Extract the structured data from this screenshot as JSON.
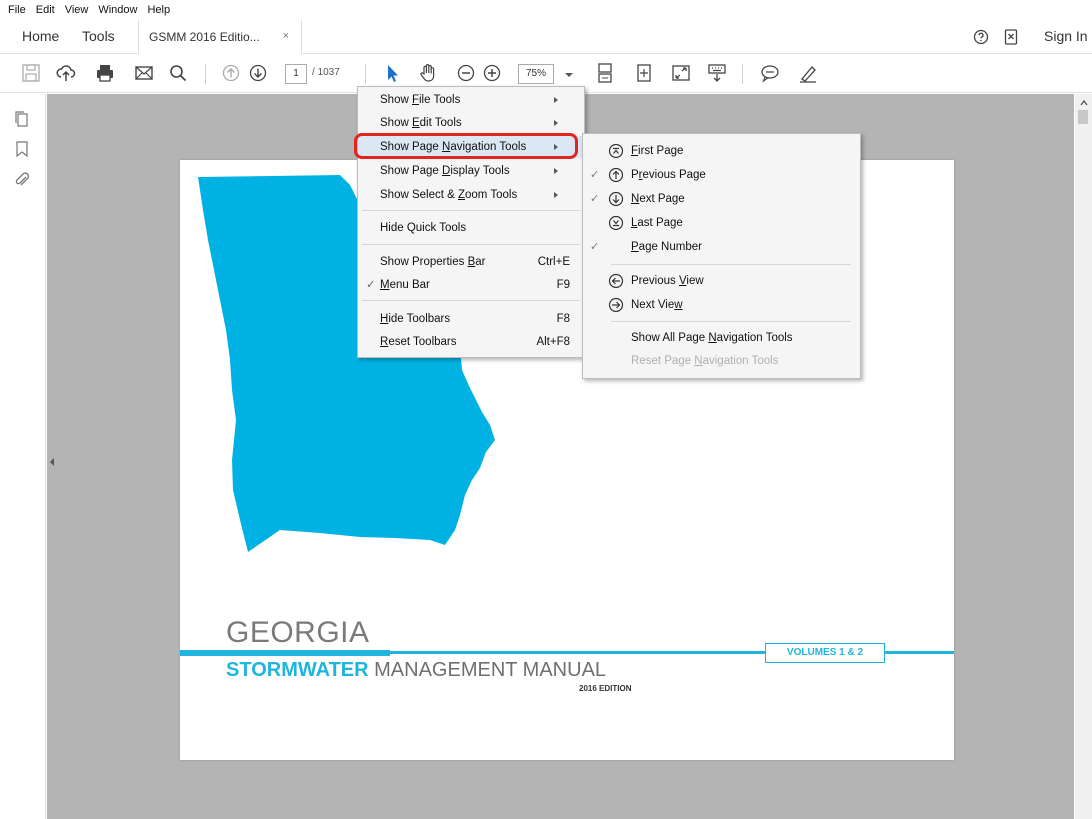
{
  "menubar": {
    "items": [
      "File",
      "Edit",
      "View",
      "Window",
      "Help"
    ]
  },
  "tabs": {
    "home": "Home",
    "tools": "Tools",
    "document": "GSMM 2016 Editio...",
    "close_glyph": "×"
  },
  "header": {
    "sign_in": "Sign In"
  },
  "toolbar": {
    "page_current": "1",
    "page_total": "/ 1037",
    "zoom": "75%"
  },
  "document": {
    "title": "GEORGIA",
    "subtitle_accent": "STORMWATER",
    "subtitle_rest": " MANAGEMENT MANUAL",
    "edition": "2016 EDITION",
    "volumes": "VOLUMES 1 & 2",
    "map_color": "#00b2e3"
  },
  "context_menu": {
    "items": [
      {
        "pre": "Show ",
        "u": "F",
        "post": "ile Tools",
        "shortcut": "",
        "submenu": true,
        "checked": false
      },
      {
        "pre": "Show ",
        "u": "E",
        "post": "dit Tools",
        "shortcut": "",
        "submenu": true,
        "checked": false
      },
      {
        "pre": "Show Page ",
        "u": "N",
        "post": "avigation Tools",
        "shortcut": "",
        "submenu": true,
        "checked": false
      },
      {
        "pre": "Show Page ",
        "u": "D",
        "post": "isplay Tools",
        "shortcut": "",
        "submenu": true,
        "checked": false
      },
      {
        "pre": "Show Select & ",
        "u": "Z",
        "post": "oom Tools",
        "shortcut": "",
        "submenu": true,
        "checked": false
      },
      {
        "pre": "Hide Quick Tools",
        "u": "",
        "post": "",
        "shortcut": "",
        "submenu": false,
        "checked": false
      },
      {
        "pre": "Show Properties ",
        "u": "B",
        "post": "ar",
        "shortcut": "Ctrl+E",
        "submenu": false,
        "checked": false
      },
      {
        "pre": "",
        "u": "M",
        "post": "enu Bar",
        "shortcut": "F9",
        "submenu": false,
        "checked": true
      },
      {
        "pre": "",
        "u": "H",
        "post": "ide Toolbars",
        "shortcut": "F8",
        "submenu": false,
        "checked": false
      },
      {
        "pre": "",
        "u": "R",
        "post": "eset Toolbars",
        "shortcut": "Alt+F8",
        "submenu": false,
        "checked": false
      }
    ],
    "check_glyph": "✓",
    "highlight_color": "#e0251f"
  },
  "submenu": {
    "items": [
      {
        "pre": "",
        "u": "F",
        "post": "irst Page",
        "icon": "first-page-icon",
        "checked": false,
        "disabled": false
      },
      {
        "pre": "P",
        "u": "r",
        "post": "evious Page",
        "icon": "previous-page-icon",
        "checked": true,
        "disabled": false
      },
      {
        "pre": "",
        "u": "N",
        "post": "ext Page",
        "icon": "next-page-icon",
        "checked": true,
        "disabled": false
      },
      {
        "pre": "",
        "u": "L",
        "post": "ast Page",
        "icon": "last-page-icon",
        "checked": false,
        "disabled": false
      },
      {
        "pre": "",
        "u": "P",
        "post": "age Number",
        "icon": "",
        "checked": true,
        "disabled": false
      },
      {
        "pre": "Previous ",
        "u": "V",
        "post": "iew",
        "icon": "previous-view-icon",
        "checked": false,
        "disabled": false
      },
      {
        "pre": "Next Vie",
        "u": "w",
        "post": "",
        "icon": "next-view-icon",
        "checked": false,
        "disabled": false
      },
      {
        "pre": "Show All Page ",
        "u": "N",
        "post": "avigation Tools",
        "icon": "",
        "checked": false,
        "disabled": false
      },
      {
        "pre": "Reset Page ",
        "u": "N",
        "post": "avigation Tools",
        "icon": "",
        "checked": false,
        "disabled": true
      }
    ]
  }
}
